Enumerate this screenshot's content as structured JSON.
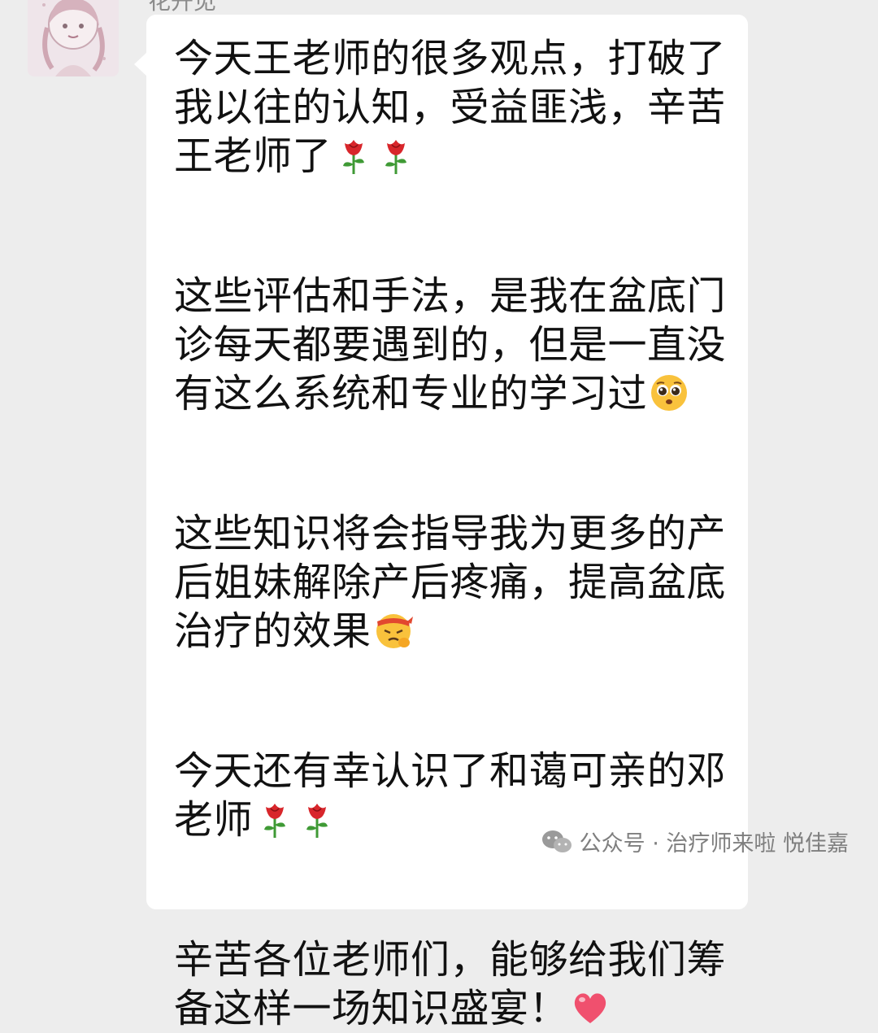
{
  "chat": {
    "sender_name": "花开见",
    "message": {
      "paragraphs": [
        {
          "lines": [
            {
              "text": "今天王老师的很多观点，打破了",
              "emojis": []
            },
            {
              "text": "我以往的认知，受益匪浅，辛苦",
              "emojis": []
            },
            {
              "text": "王老师了",
              "emojis": [
                "rose",
                "rose"
              ]
            }
          ]
        },
        {
          "lines": [
            {
              "text": "这些评估和手法，是我在盆底门",
              "emojis": []
            },
            {
              "text": "诊每天都要遇到的，但是一直没",
              "emojis": []
            },
            {
              "text": "有这么系统和专业的学习过",
              "emojis": [
                "pleading-face"
              ]
            }
          ]
        },
        {
          "lines": [
            {
              "text": "这些知识将会指导我为更多的产",
              "emojis": []
            },
            {
              "text": "后姐妹解除产后疼痛，提高盆底",
              "emojis": []
            },
            {
              "text": "治疗的效果",
              "emojis": [
                "determined-face-headband"
              ]
            }
          ]
        },
        {
          "lines": [
            {
              "text": "今天还有幸认识了和蔼可亲的邓",
              "emojis": []
            },
            {
              "text": "老师",
              "emojis": [
                "rose",
                "rose"
              ]
            }
          ]
        },
        {
          "lines": [
            {
              "text": "辛苦各位老师们，能够给我们筹",
              "emojis": []
            },
            {
              "text": "备这样一场知识盛宴！",
              "emojis": [
                "heart"
              ]
            }
          ]
        }
      ]
    }
  },
  "watermark": {
    "text": "公众号 · 治疗师来啦 悦佳嘉",
    "icon": "wechat-official-account-icon"
  },
  "colors": {
    "background": "#ededed",
    "bubble": "#ffffff",
    "text": "#111111",
    "rose_red": "#d8262b",
    "stem_green": "#3f9a35",
    "emoji_yellow": "#f9c23c",
    "heart_pink": "#f0506e",
    "watermark": "#7f7f7f"
  }
}
